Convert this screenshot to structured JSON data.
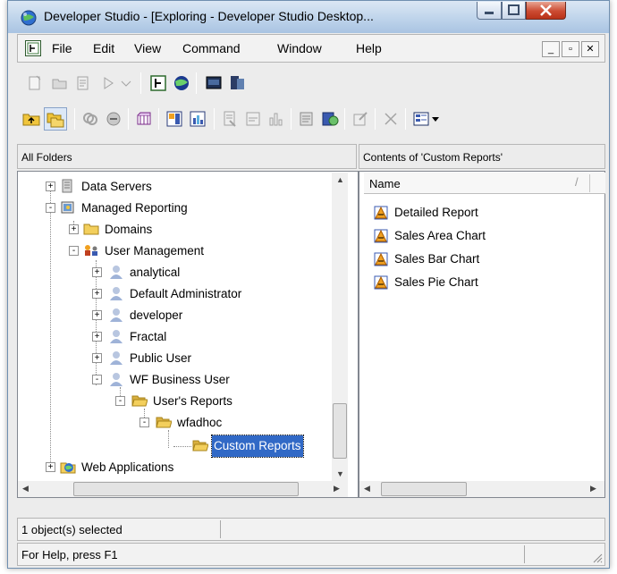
{
  "window": {
    "title": "Developer Studio - [Exploring - Developer Studio Desktop..."
  },
  "menu": {
    "items": [
      "File",
      "Edit",
      "View",
      "Command",
      "Window",
      "Help"
    ]
  },
  "panes": {
    "left_header": "All Folders",
    "right_header": "Contents of 'Custom Reports'",
    "list_column": "Name"
  },
  "tree": [
    {
      "label": "Data Servers",
      "icon": "server-icon",
      "expander": "+"
    },
    {
      "label": "Managed Reporting",
      "icon": "managed-reporting-icon",
      "expander": "-"
    },
    {
      "label": "Domains",
      "icon": "folder-icon",
      "expander": "+"
    },
    {
      "label": "User Management",
      "icon": "users-icon",
      "expander": "-"
    },
    {
      "label": "analytical",
      "icon": "user-icon",
      "expander": "+"
    },
    {
      "label": "Default Administrator",
      "icon": "user-icon",
      "expander": "+"
    },
    {
      "label": "developer",
      "icon": "user-icon",
      "expander": "+"
    },
    {
      "label": "Fractal",
      "icon": "user-icon",
      "expander": "+"
    },
    {
      "label": "Public User",
      "icon": "user-icon",
      "expander": "+"
    },
    {
      "label": "WF Business User",
      "icon": "user-icon",
      "expander": "-"
    },
    {
      "label": "User's Reports",
      "icon": "folder-open-icon",
      "expander": "-"
    },
    {
      "label": "wfadhoc",
      "icon": "folder-open-icon",
      "expander": "-"
    },
    {
      "label": "Custom Reports",
      "icon": "folder-open-icon",
      "expander": "",
      "selected": true
    },
    {
      "label": "Web Applications",
      "icon": "web-app-icon",
      "expander": "+"
    }
  ],
  "contents": [
    {
      "label": "Detailed Report",
      "icon": "report-icon"
    },
    {
      "label": "Sales Area Chart",
      "icon": "report-icon"
    },
    {
      "label": "Sales Bar Chart",
      "icon": "report-icon"
    },
    {
      "label": "Sales Pie Chart",
      "icon": "report-icon"
    }
  ],
  "status": {
    "selection": "1 object(s) selected",
    "help": "For Help, press F1"
  },
  "colors": {
    "selection": "#3169c6",
    "folder": "#f3cf5c",
    "user": "#9fb3d8"
  }
}
